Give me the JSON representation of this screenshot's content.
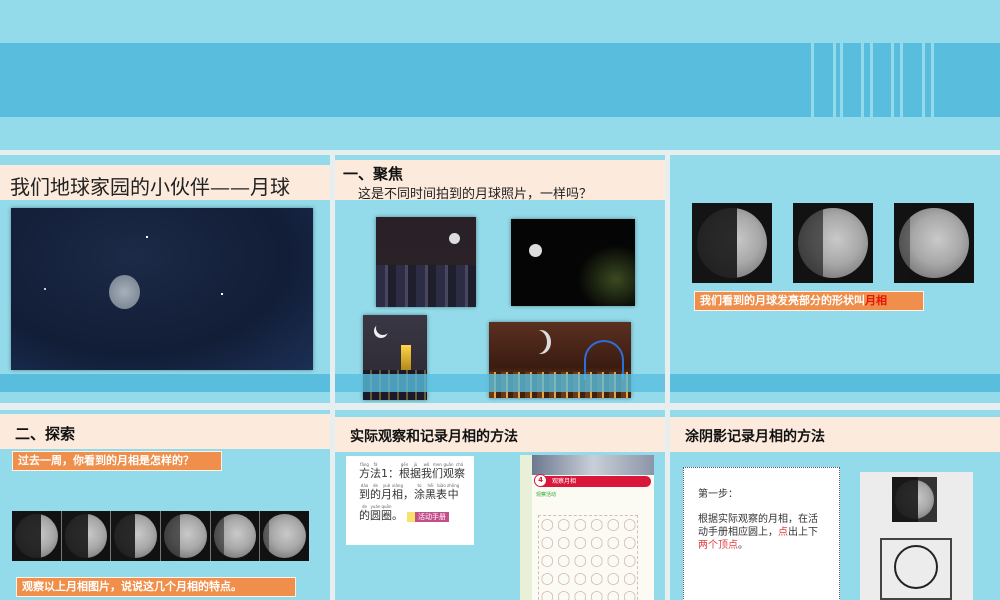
{
  "colors": {
    "sky": "#93dbea",
    "band": "#59bede",
    "title_band": "#fcebdd",
    "label": "#ef8f4b",
    "highlight": "#e8140c"
  },
  "slides": [
    {
      "title": "我们地球家园的小伙伴——月球"
    },
    {
      "heading": "一、聚焦",
      "question": "这是不同时间拍到的月球照片，一样吗？"
    },
    {
      "caption_prefix": "我们看到的月球发亮部分的形状叫",
      "caption_highlight": "月相"
    },
    {
      "heading": "二、探索",
      "prompt": "过去一周，你看到的月相是怎样的？",
      "task": "观察以上月相图片，说说这几个月相的特点。"
    },
    {
      "heading": "实际观察和记录月相的方法",
      "method_lines": [
        [
          [
            "方",
            "fāng"
          ],
          [
            "法",
            "fǎ"
          ],
          [
            "1：",
            ""
          ],
          [
            "根",
            "gēn"
          ],
          [
            "据",
            "jù"
          ],
          [
            "我",
            "wǒ"
          ],
          [
            "们",
            "men"
          ],
          [
            "观",
            "guān"
          ],
          [
            "察",
            "chá"
          ]
        ],
        [
          [
            "到",
            "dào"
          ],
          [
            "的",
            "de"
          ],
          [
            "月",
            "yuè"
          ],
          [
            "相",
            "xiàng"
          ],
          [
            "，",
            ""
          ],
          [
            "涂",
            "tú"
          ],
          [
            "黑",
            "hēi"
          ],
          [
            "表",
            "biǎo"
          ],
          [
            "中",
            "zhōng"
          ]
        ],
        [
          [
            "的",
            "de"
          ],
          [
            "圆",
            "yuán"
          ],
          [
            "圈",
            "quān"
          ],
          [
            "。",
            ""
          ]
        ]
      ],
      "tag": "活动手册",
      "workbook_number": "4",
      "workbook_title": "观察月相",
      "workbook_sub": "观察活动"
    },
    {
      "heading": "涂阴影记录月相的方法",
      "step": "第一步：",
      "instr_a": "根据实际观察的月相，在活动手册相应圆上，",
      "instr_red1": "点",
      "instr_b": "出上下",
      "instr_red2": "两个顶点",
      "instr_end": "。"
    }
  ]
}
